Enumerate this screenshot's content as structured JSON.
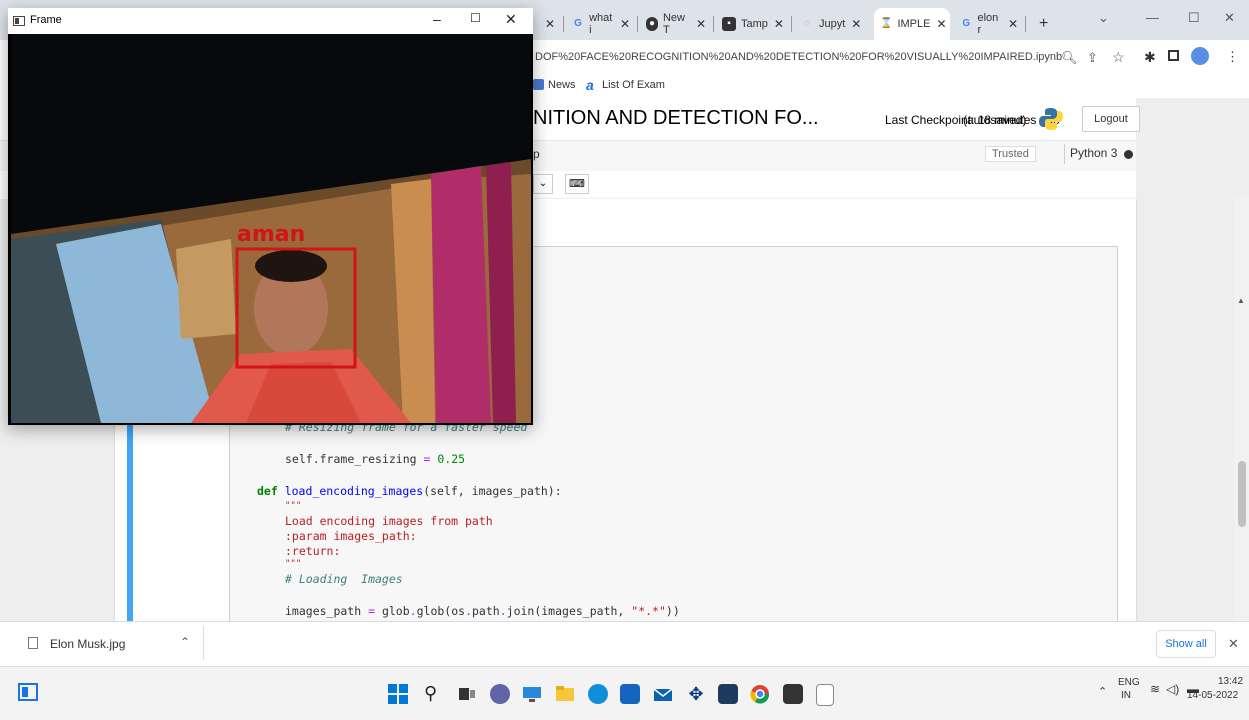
{
  "browser": {
    "tabs": [
      {
        "title": "",
        "icon": "generic-tab-icon"
      },
      {
        "title": "what i",
        "icon": "google-icon"
      },
      {
        "title": "New T",
        "icon": "github-icon"
      },
      {
        "title": "Tamp",
        "icon": "tampermonkey-icon"
      },
      {
        "title": "Jupyt",
        "icon": "jupyter-icon"
      },
      {
        "title": "IMPLE",
        "icon": "hourglass-icon"
      },
      {
        "title": "elon r",
        "icon": "google-icon"
      }
    ],
    "new_tab": "+",
    "url": "DOF%20FACE%20RECOGNITION%20AND%20DETECTION%20FOR%20VISUALLY%20IMPAIRED.ipynb",
    "bookmarks": [
      {
        "label": "News"
      },
      {
        "label": "List Of Exam"
      }
    ]
  },
  "jupyter": {
    "title": "NITION AND DETECTION FO...",
    "checkpoint": "Last Checkpoint: 18 minutes ago",
    "autosaved": "(autosaved)",
    "logout": "Logout",
    "menu_partial": "p",
    "trusted": "Trusted",
    "kernel": "Python 3"
  },
  "code_lines": [
    {
      "tokens": [
        {
          "t": "# Resizing frame for a faster speed",
          "c": "cmt"
        }
      ]
    },
    {
      "tokens": [
        {
          "t": "self",
          "c": ""
        },
        {
          "t": ".frame_resizing ",
          "c": ""
        },
        {
          "t": "=",
          "c": "op"
        },
        {
          "t": " ",
          "c": ""
        },
        {
          "t": "0.25",
          "c": "num"
        }
      ]
    },
    {
      "tokens": [
        {
          "t": "def ",
          "c": "kw"
        },
        {
          "t": "load_encoding_images",
          "c": "fn"
        },
        {
          "t": "(self, images_path):",
          "c": ""
        }
      ]
    },
    {
      "tokens": [
        {
          "t": "\"\"\"",
          "c": "str"
        }
      ]
    },
    {
      "tokens": [
        {
          "t": "Load encoding images from path",
          "c": "str"
        }
      ]
    },
    {
      "tokens": [
        {
          "t": ":param images_path:",
          "c": "str"
        }
      ]
    },
    {
      "tokens": [
        {
          "t": ":return:",
          "c": "str"
        }
      ]
    },
    {
      "tokens": [
        {
          "t": "\"\"\"",
          "c": "str"
        }
      ]
    },
    {
      "tokens": [
        {
          "t": "# Loading  Images",
          "c": "cmt"
        }
      ]
    },
    {
      "tokens": [
        {
          "t": "images_path ",
          "c": ""
        },
        {
          "t": "=",
          "c": "op"
        },
        {
          "t": " glob",
          "c": ""
        },
        {
          "t": ".",
          "c": "op"
        },
        {
          "t": "glob(os",
          "c": ""
        },
        {
          "t": ".",
          "c": "op"
        },
        {
          "t": "path",
          "c": ""
        },
        {
          "t": ".",
          "c": "op"
        },
        {
          "t": "join(images_path, ",
          "c": ""
        },
        {
          "t": "\"*.*\"",
          "c": "str"
        },
        {
          "t": "))",
          "c": ""
        }
      ]
    }
  ],
  "frame_window": {
    "title": "Frame",
    "face_label": "aman",
    "box_color": "#d21414"
  },
  "downloads": {
    "file": "Elon Musk.jpg",
    "show_all": "Show all"
  },
  "taskbar": {
    "lang_top": "ENG",
    "lang_bottom": "IN",
    "time": "13:42",
    "date": "14-05-2022"
  }
}
